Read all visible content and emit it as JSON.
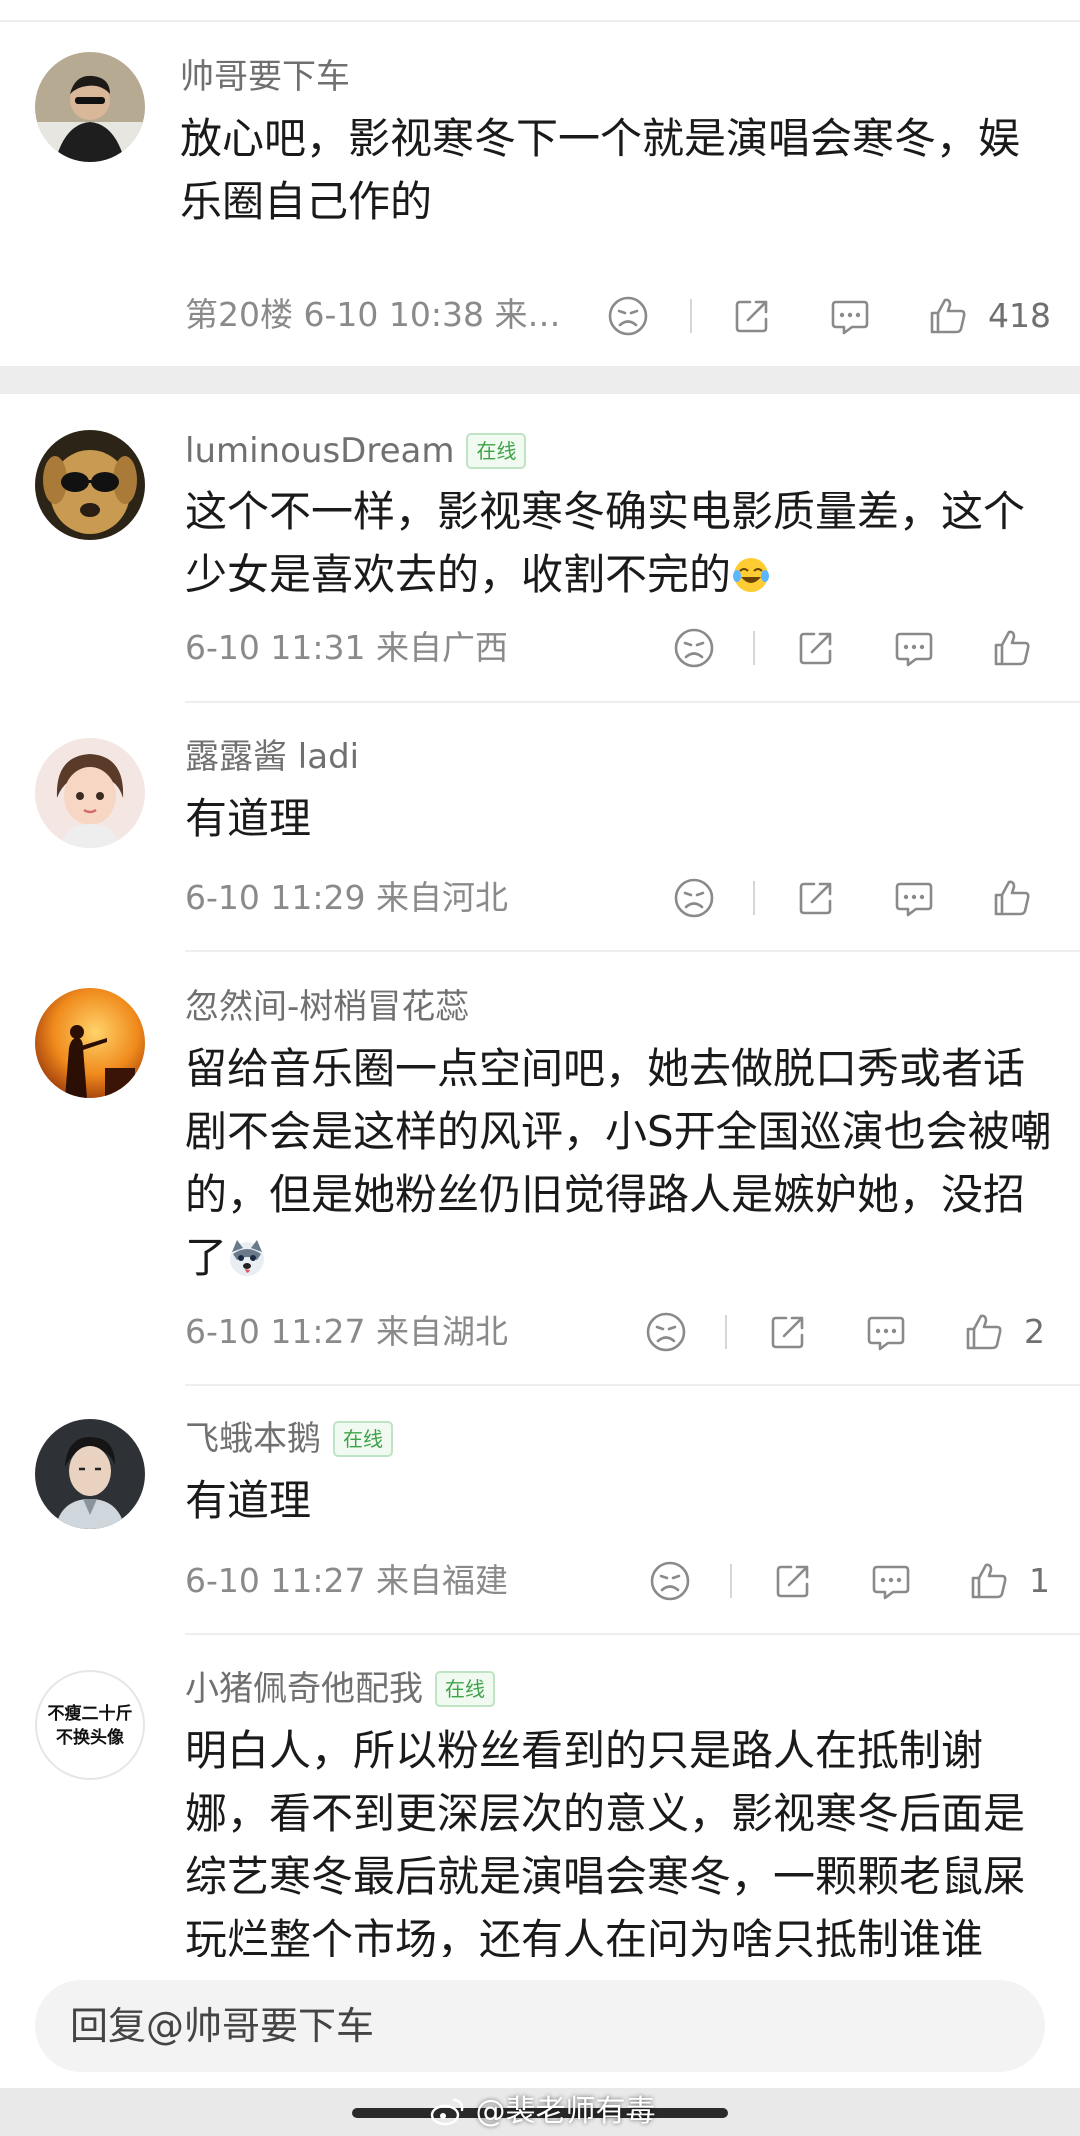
{
  "comments": [
    {
      "username": "帅哥要下车",
      "online_badge": "",
      "content": "放心吧，影视寒冬下一个就是演唱会寒冬，娱乐圈自己作的",
      "meta": "第20楼 6-10 10:38 来…",
      "likes": "418"
    },
    {
      "username": "luminousDream",
      "online_badge": "在线",
      "content": "这个不一样，影视寒冬确实电影质量差，这个少女是喜欢去的，收割不完的",
      "meta": "6-10 11:31 来自广西",
      "likes": ""
    },
    {
      "username": "露露酱 ladi",
      "online_badge": "",
      "content": "有道理",
      "meta": "6-10 11:29 来自河北",
      "likes": ""
    },
    {
      "username": "忽然间-树梢冒花蕊",
      "online_badge": "",
      "content": "留给音乐圈一点空间吧，她去做脱口秀或者话剧不会是这样的风评，小S开全国巡演也会被嘲的，但是她粉丝仍旧觉得路人是嫉妒她，没招了",
      "meta": "6-10 11:27 来自湖北",
      "likes": "2"
    },
    {
      "username": "飞蛾本鹅",
      "online_badge": "在线",
      "content": "有道理",
      "meta": "6-10 11:27 来自福建",
      "likes": "1"
    },
    {
      "username": "小猪佩奇他配我",
      "online_badge": "在线",
      "content": "明白人，所以粉丝看到的只是路人在抵制谢娜，看不到更深层次的意义，影视寒冬后面是综艺寒冬最后就是演唱会寒冬，一颗颗老鼠屎玩烂整个市场，还有人在问为啥只抵制谁谁",
      "meta": "",
      "likes": "",
      "avatar_text_line1": "不瘦二十斤",
      "avatar_text_line2": "不换头像"
    }
  ],
  "reply_placeholder": "回复@帅哥要下车",
  "watermark": "@裴老师有毒",
  "colors": {
    "online_green": "#3fa34a",
    "meta_gray": "#8a8a8a",
    "separator": "#ededed"
  },
  "icons": [
    "dislike-icon",
    "share-icon",
    "comment-icon",
    "like-icon",
    "weibo-logo-icon"
  ]
}
